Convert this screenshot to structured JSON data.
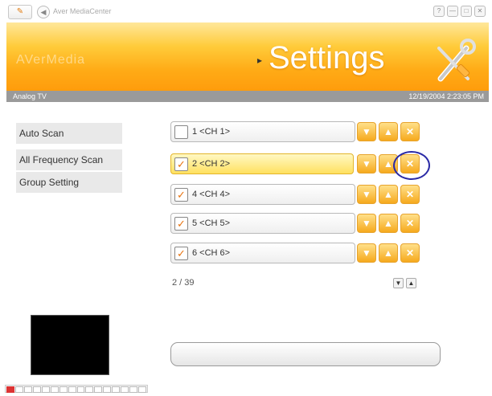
{
  "app": {
    "name": "Aver MediaCenter",
    "brand": "AVerMedia"
  },
  "window_controls": [
    "?",
    "—",
    "□",
    "✕"
  ],
  "banner": {
    "title": "Settings",
    "arrow": "▸"
  },
  "status": {
    "source": "Analog TV",
    "timestamp": "12/19/2004 2:23:05 PM"
  },
  "menu": [
    {
      "label": "Auto Scan"
    },
    {
      "label": "All Frequency Scan"
    },
    {
      "label": "Group Setting"
    }
  ],
  "channels": [
    {
      "label": "1  <CH 1>",
      "checked": false,
      "check_glyph": ""
    },
    {
      "label": "2  <CH 2>",
      "checked": true,
      "check_glyph": "✓"
    },
    {
      "label": "4  <CH 4>",
      "checked": true,
      "check_glyph": "✓"
    },
    {
      "label": "5  <CH 5>",
      "checked": true,
      "check_glyph": "✓"
    },
    {
      "label": "6  <CH 6>",
      "checked": true,
      "check_glyph": "✓"
    }
  ],
  "channel_buttons": {
    "move_down": "▼",
    "move_up": "▲",
    "delete": "✕"
  },
  "pagination": {
    "text": "2 / 39",
    "down": "▼",
    "up": "▲"
  },
  "colors": {
    "accent": "#ffab16",
    "banner_light": "#ffe79a",
    "status_bar": "#9a9a9a",
    "highlight": "#2a2aa6"
  }
}
